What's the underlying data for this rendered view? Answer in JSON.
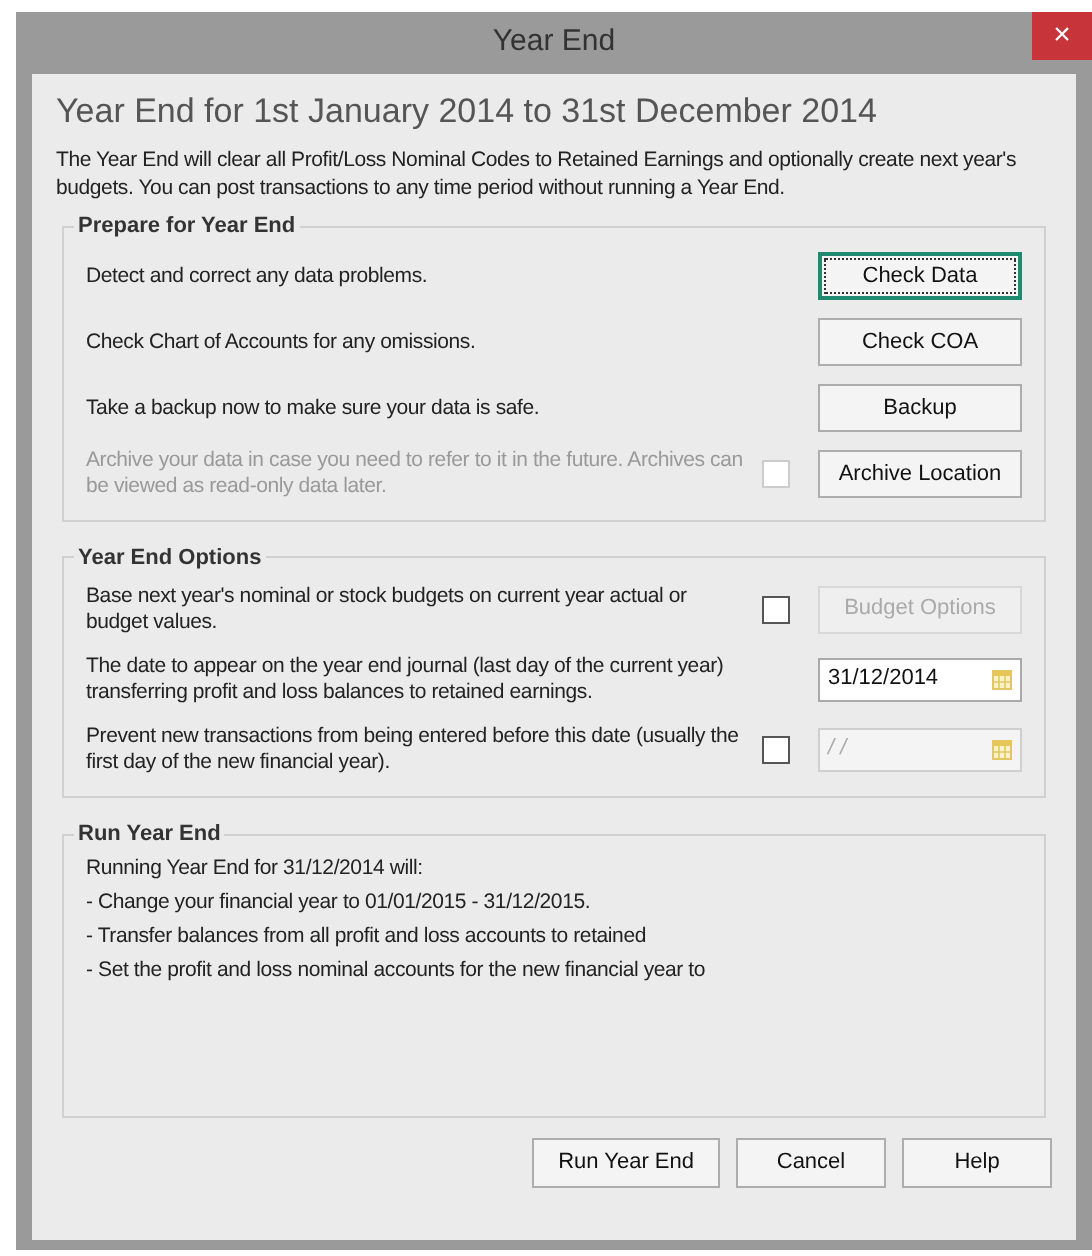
{
  "window": {
    "title": "Year End",
    "close": "×"
  },
  "heading": "Year End for 1st January 2014 to 31st December 2014",
  "intro": "The Year End will clear all Profit/Loss Nominal Codes to Retained Earnings and optionally create next year's budgets. You can post transactions to any time period without running a Year End.",
  "prepare": {
    "legend": "Prepare for Year End",
    "rows": [
      {
        "text": "Detect and correct any data problems.",
        "disabled": false,
        "button": {
          "label": "Check Data",
          "focused": true,
          "disabled": false
        }
      },
      {
        "text": "Check Chart of Accounts for any omissions.",
        "disabled": false,
        "button": {
          "label": "Check COA",
          "focused": false,
          "disabled": false
        }
      },
      {
        "text": "Take a backup now to make sure your data is safe.",
        "disabled": false,
        "button": {
          "label": "Backup",
          "focused": false,
          "disabled": false
        }
      },
      {
        "text": "Archive your data in case you need to refer to it in the future. Archives can be viewed as read-only data later.",
        "disabled": true,
        "checkbox": {
          "checked": false
        },
        "button": {
          "label": "Archive Location",
          "focused": false,
          "disabled": false
        }
      }
    ]
  },
  "options": {
    "legend": "Year End Options",
    "rows": [
      {
        "kind": "button",
        "text": "Base next year's nominal or stock budgets on current year actual or budget values.",
        "checkbox": {
          "checked": false
        },
        "button": {
          "label": "Budget Options",
          "focused": false,
          "disabled": true
        }
      },
      {
        "kind": "date",
        "text": "The date to appear on the year end journal (last day of the current year) transferring profit and loss balances to retained earnings.",
        "field": {
          "value": "31/12/2014",
          "disabled": false
        }
      },
      {
        "kind": "date",
        "text": "Prevent new transactions from being entered before this date (usually the first day of the new financial year).",
        "checkbox": {
          "checked": false
        },
        "field": {
          "value": "/ /",
          "disabled": true
        }
      }
    ]
  },
  "run": {
    "legend": "Run Year End",
    "lines": [
      "Running Year End for 31/12/2014 will:",
      "- Change your financial year to 01/01/2015 - 31/12/2015.",
      "- Transfer balances from all profit and loss accounts to retained",
      "- Set the profit and loss nominal accounts for the new financial year to"
    ]
  },
  "buttons": [
    {
      "label": "Run Year End"
    },
    {
      "label": "Cancel"
    },
    {
      "label": "Help"
    }
  ]
}
